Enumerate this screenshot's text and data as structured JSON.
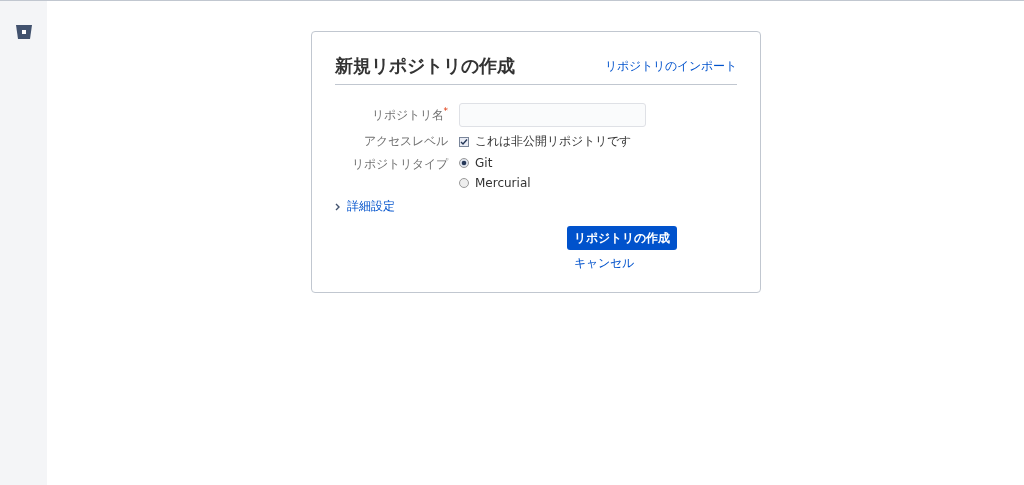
{
  "form": {
    "title": "新規リポジトリの作成",
    "import_link": "リポジトリのインポート",
    "name_field": {
      "label": "リポジトリ名",
      "required_mark": "*"
    },
    "access": {
      "label": "アクセスレベル",
      "option": "これは非公開リポジトリです",
      "checked": true
    },
    "type": {
      "label": "リポジトリタイプ",
      "options": [
        {
          "label": "Git",
          "selected": true
        },
        {
          "label": "Mercurial",
          "selected": false
        }
      ]
    },
    "advanced": {
      "label": "詳細設定",
      "expanded": false
    },
    "submit": "リポジトリの作成",
    "cancel": "キャンセル"
  }
}
